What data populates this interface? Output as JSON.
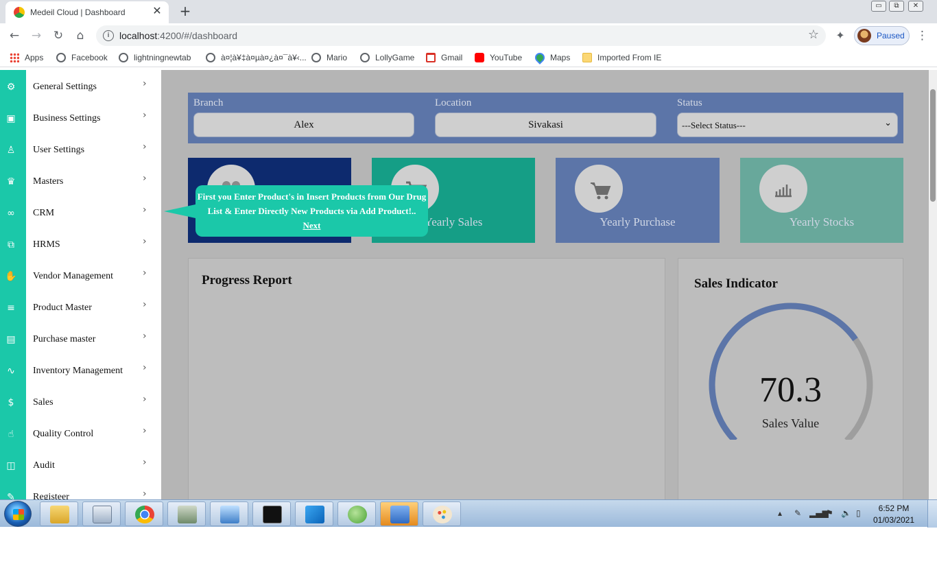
{
  "browser": {
    "tab_title": "Medeil Cloud | Dashboard",
    "tab_close": "✕",
    "new_tab": "+",
    "url_host": "localhost",
    "url_rest": ":4200/#/dashboard",
    "info": "i",
    "profile_status": "Paused",
    "window_controls": [
      "▭",
      "⧉",
      "✕"
    ],
    "bookmarks": [
      {
        "label": "Apps",
        "icon": "apps-icon"
      },
      {
        "label": "Facebook",
        "icon": "globe-icon"
      },
      {
        "label": "lightningnewtab",
        "icon": "globe-icon"
      },
      {
        "label": "à¤¦à¥‡à¤µà¤¿à¤¯à¥‹...",
        "icon": "globe-icon"
      },
      {
        "label": "Mario",
        "icon": "globe-icon"
      },
      {
        "label": "LollyGame",
        "icon": "globe-icon"
      },
      {
        "label": "Gmail",
        "icon": "gmail-icon"
      },
      {
        "label": "YouTube",
        "icon": "youtube-icon"
      },
      {
        "label": "Maps",
        "icon": "maps-icon"
      },
      {
        "label": "Imported From IE",
        "icon": "folder-icon"
      }
    ]
  },
  "sidebar": {
    "items": [
      {
        "label": "General Settings",
        "icon": "gear-icon"
      },
      {
        "label": "Business Settings",
        "icon": "save-icon"
      },
      {
        "label": "User Settings",
        "icon": "user-icon"
      },
      {
        "label": "Masters",
        "icon": "crown-icon"
      },
      {
        "label": "CRM",
        "icon": "link-icon"
      },
      {
        "label": "HRMS",
        "icon": "people-icon"
      },
      {
        "label": "Vendor Management",
        "icon": "hand-icon"
      },
      {
        "label": "Product Master",
        "icon": "database-icon"
      },
      {
        "label": "Purchase master",
        "icon": "book-icon"
      },
      {
        "label": "Inventory Management",
        "icon": "pulse-icon"
      },
      {
        "label": "Sales",
        "icon": "dollar-icon"
      },
      {
        "label": "Quality Control",
        "icon": "thumbs-up-icon"
      },
      {
        "label": "Audit",
        "icon": "open-book-icon"
      },
      {
        "label": "Registeer",
        "icon": "pencil-icon"
      }
    ],
    "chevron": "›"
  },
  "filters": {
    "branch_label": "Branch",
    "branch_value": "Alex",
    "location_label": "Location",
    "location_value": "Sivakasi",
    "status_label": "Status",
    "status_value": "---Select Status---"
  },
  "cards": [
    {
      "label": "",
      "color": "#0d2a6e",
      "icon": "users-icon"
    },
    {
      "label": "Yearly Sales",
      "color": "#159e86",
      "icon": "cart-icon"
    },
    {
      "label": "Yearly Purchase",
      "color": "#5c75a8",
      "icon": "cart-icon"
    },
    {
      "label": "Yearly Stocks",
      "color": "#68a89b",
      "icon": "bar-chart-icon"
    }
  ],
  "progress": {
    "title": "Progress Report"
  },
  "sales_indicator": {
    "title": "Sales Indicator",
    "value": "70.3",
    "value_fraction": 0.703,
    "caption": "Sales Value",
    "fill_color": "#5c75a8",
    "track_color": "#9e9e9e"
  },
  "tooltip": {
    "line1": "First you Enter Product's in Insert Products from Our Drug",
    "line2": "List & Enter Directly New Products via Add Product!..",
    "next": "Next"
  },
  "taskbar": {
    "apps": [
      "explorer-icon",
      "calculator-icon",
      "chrome-icon",
      "remote-desktop-icon",
      "control-panel-icon",
      "terminal-icon",
      "vscode-icon",
      "spring-icon",
      "users-app-icon",
      "paint-icon"
    ],
    "time": "6:52 PM",
    "date": "01/03/2021"
  }
}
